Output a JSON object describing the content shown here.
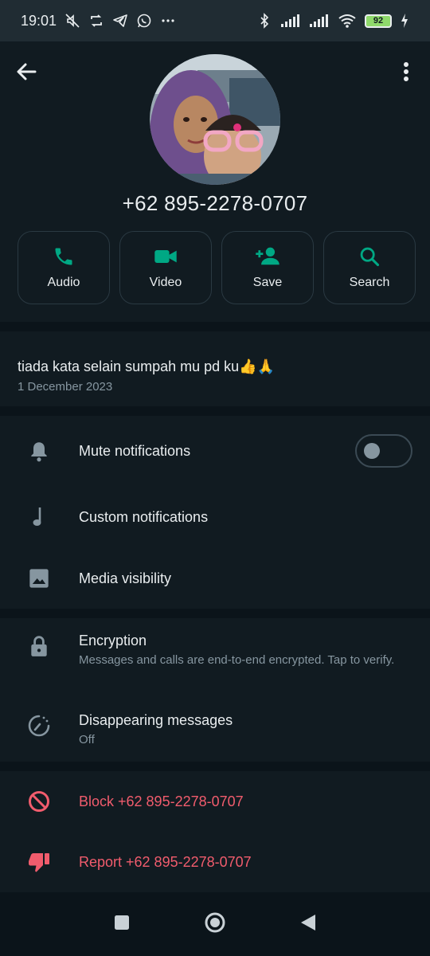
{
  "status_bar": {
    "time": "19:01",
    "battery": "92",
    "left_icons": [
      "mute-icon",
      "sync-icon",
      "telegram-icon",
      "whatsapp-icon",
      "more-dots-icon"
    ],
    "right_icons": [
      "bluetooth-icon",
      "signal-icon",
      "signal-icon",
      "wifi-icon",
      "battery-icon",
      "charging-icon"
    ]
  },
  "header": {
    "title": "+62 895-2278-0707",
    "back_icon": "arrow-left-icon",
    "menu_icon": "more-vertical-icon"
  },
  "actions": [
    {
      "label": "Audio",
      "icon": "phone-icon"
    },
    {
      "label": "Video",
      "icon": "videocam-icon"
    },
    {
      "label": "Save",
      "icon": "add-person-icon"
    },
    {
      "label": "Search",
      "icon": "search-icon"
    }
  ],
  "about": {
    "text": "tiada kata selain sumpah mu pd ku👍🙏",
    "date": "1 December 2023"
  },
  "settings": {
    "mute": {
      "label": "Mute notifications",
      "enabled": false
    },
    "custom": {
      "label": "Custom notifications"
    },
    "media": {
      "label": "Media visibility"
    }
  },
  "privacy": {
    "encryption": {
      "label": "Encryption",
      "sub": "Messages and calls are end-to-end encrypted. Tap to verify."
    },
    "disappearing": {
      "label": "Disappearing messages",
      "sub": "Off"
    }
  },
  "danger": {
    "block": "Block +62 895-2278-0707",
    "report": "Report +62 895-2278-0707"
  },
  "colors": {
    "accent": "#00a884",
    "danger": "#f15c6d",
    "background": "#111b21",
    "muted_text": "#8696a0"
  },
  "nav": [
    "recents-icon",
    "home-icon",
    "back-icon"
  ]
}
